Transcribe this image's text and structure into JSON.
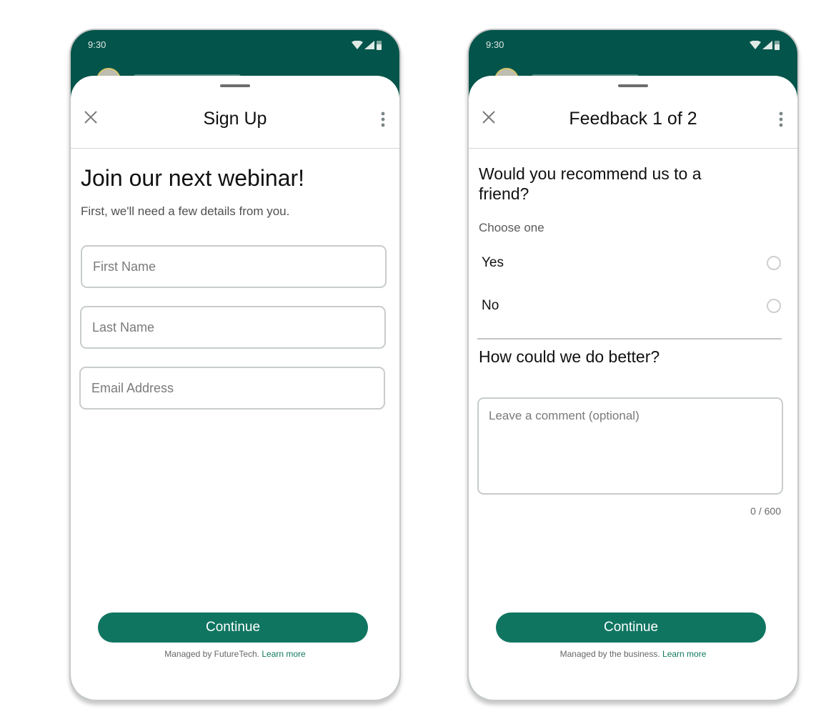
{
  "colors": {
    "brand_green": "#03544a",
    "button_green": "#0f7561",
    "link_green": "#107a5e"
  },
  "screens": [
    {
      "status_bar": {
        "time": "9:30",
        "icons": [
          "wifi-icon",
          "signal-icon",
          "battery-icon"
        ]
      },
      "header": {
        "title": "Sign Up",
        "close_icon": "close-icon",
        "more_icon": "more-vertical-icon"
      },
      "hero": {
        "title": "Join our next webinar!",
        "subtitle": "First, we'll need a few details from you."
      },
      "fields": [
        {
          "placeholder": "First Name",
          "value": ""
        },
        {
          "placeholder": "Last Name",
          "value": ""
        },
        {
          "placeholder": "Email Address",
          "value": ""
        }
      ],
      "continue_label": "Continue",
      "footer": {
        "text": "Managed by FutureTech.",
        "link": "Learn more"
      }
    },
    {
      "status_bar": {
        "time": "9:30",
        "icons": [
          "wifi-icon",
          "signal-icon",
          "battery-icon"
        ]
      },
      "header": {
        "title": "Feedback 1 of 2",
        "close_icon": "close-icon",
        "more_icon": "more-vertical-icon"
      },
      "question1": {
        "title": "Would you recommend us to a friend?",
        "hint": "Choose one",
        "options": [
          {
            "label": "Yes",
            "selected": false
          },
          {
            "label": "No",
            "selected": false
          }
        ]
      },
      "question2": {
        "title": "How could we do better?",
        "placeholder": "Leave a comment (optional)",
        "value": "",
        "counter": "0 / 600"
      },
      "continue_label": "Continue",
      "footer": {
        "text": "Managed by the business.",
        "link": "Learn more"
      }
    }
  ]
}
